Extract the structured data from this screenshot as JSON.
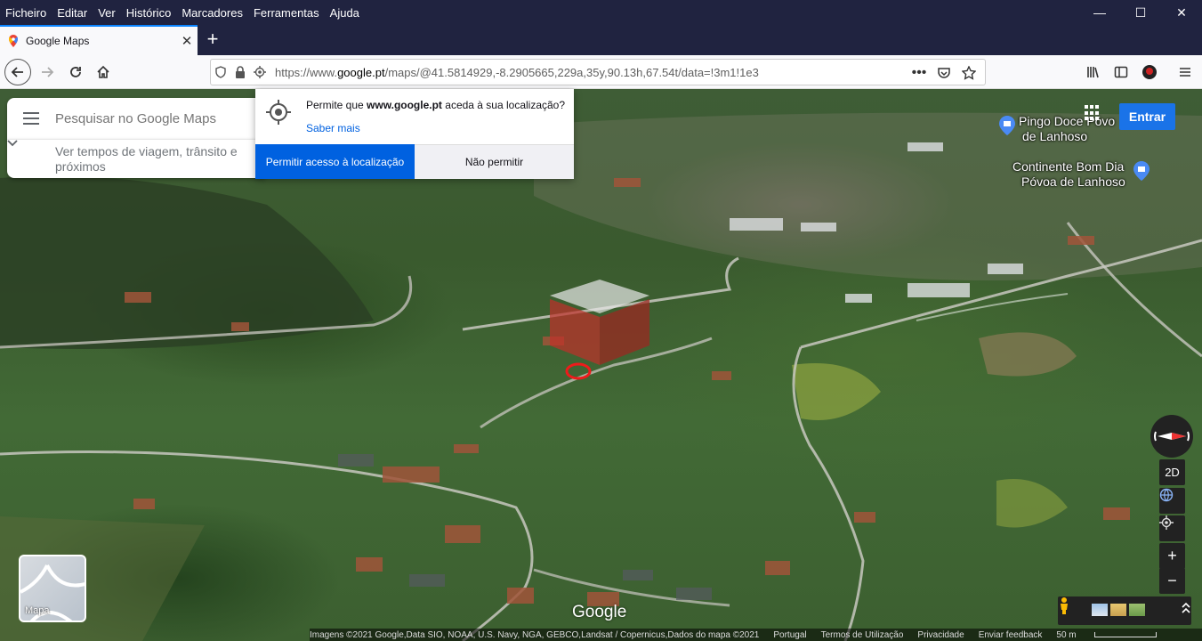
{
  "menubar": {
    "items": [
      "Ficheiro",
      "Editar",
      "Ver",
      "Histórico",
      "Marcadores",
      "Ferramentas",
      "Ajuda"
    ],
    "controls": {
      "minimize": "—",
      "maximize": "☐",
      "close": "✕"
    }
  },
  "tab": {
    "title": "Google Maps",
    "close": "✕",
    "new_tab": "+"
  },
  "urlbar": {
    "url_prefix": "https://www.",
    "url_domain": "google.pt",
    "url_rest": "/maps/@41.5814929,-8.2905665,229a,35y,90.13h,67.54t/data=!3m1!1e3"
  },
  "maps": {
    "search_placeholder": "Pesquisar no Google Maps",
    "travel_text": "Ver tempos de viagem, trânsito e próximos",
    "signin": "Entrar",
    "places": [
      {
        "name": "Pingo Doce Póvoa de Lanhoso",
        "line1": "Pingo Doce Póvo",
        "line2": "de Lanhoso"
      },
      {
        "name": "Continente Bom Dia Póvoa de Lanhoso",
        "line1": "Continente Bom Dia",
        "line2": "Póvoa de Lanhoso"
      }
    ],
    "layer_label": "Mapa",
    "view_2d": "2D",
    "zoom_in": "+",
    "zoom_out": "−",
    "logo": "Google"
  },
  "permission": {
    "message_prefix": "Permite que ",
    "message_domain": "www.google.pt",
    "message_suffix": " aceda à sua localização?",
    "learn_more": "Saber mais",
    "allow": "Permitir acesso à localização",
    "deny": "Não permitir"
  },
  "footer": {
    "attribution": "Imagens ©2021 Google,Data SIO, NOAA, U.S. Navy, NGA, GEBCO,Landsat / Copernicus,Dados do mapa ©2021",
    "country": "Portugal",
    "terms": "Termos de Utilização",
    "privacy": "Privacidade",
    "feedback": "Enviar feedback",
    "scale": "50 m"
  },
  "colors": {
    "accent": "#0061e0",
    "signin_blue": "#1a73e8",
    "chrome_dark": "#202340"
  }
}
